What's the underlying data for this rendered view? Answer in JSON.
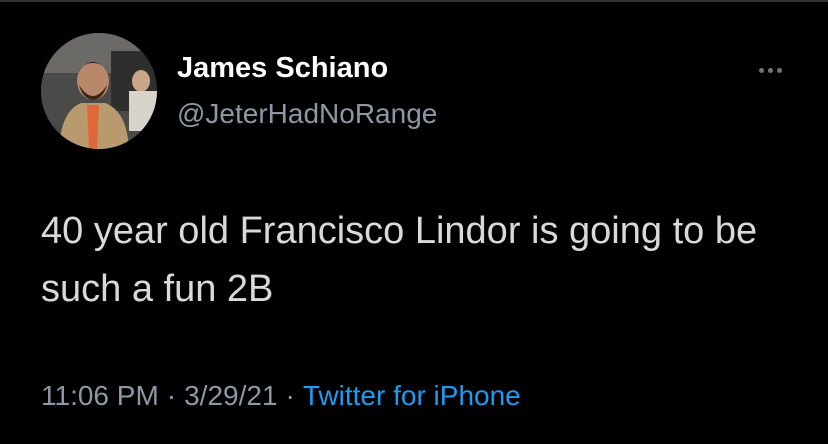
{
  "tweet": {
    "author": {
      "display_name": "James Schiano",
      "handle": "@JeterHadNoRange"
    },
    "text": "40 year old Francisco Lindor is going to be such a fun 2B",
    "time": "11:06 PM",
    "date": "3/29/21",
    "separator": "·",
    "source": "Twitter for iPhone"
  },
  "icons": {
    "more": "more-horizontal-icon"
  },
  "colors": {
    "background": "#000000",
    "name": "#ffffff",
    "secondary_text": "#8b98a5",
    "body_text": "#d9d9d9",
    "link": "#1d9bf0"
  }
}
